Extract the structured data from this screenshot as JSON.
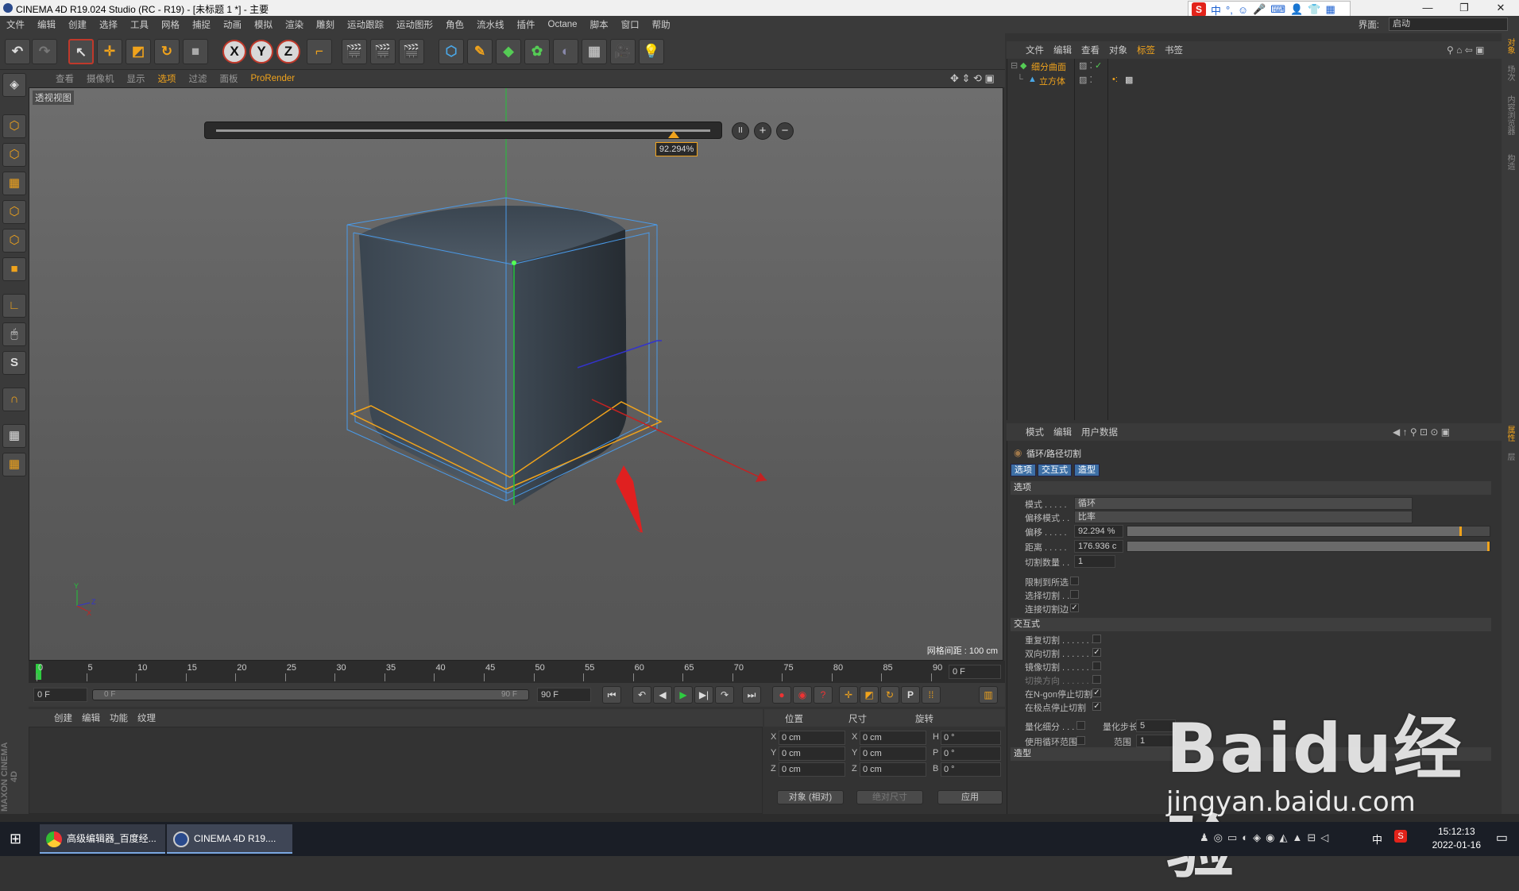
{
  "window": {
    "title": "CINEMA 4D R19.024 Studio (RC - R19) - [未标题 1 *] - 主要",
    "minimize": "—",
    "maximize": "❐",
    "close": "✕"
  },
  "ime": {
    "logo": "S",
    "lang": "中",
    "icons": [
      "°,",
      "☺",
      "🎤",
      "⌨",
      "👤",
      "👕",
      "▦"
    ]
  },
  "menu": [
    "文件",
    "编辑",
    "创建",
    "选择",
    "工具",
    "网格",
    "捕捉",
    "动画",
    "模拟",
    "渲染",
    "雕刻",
    "运动跟踪",
    "运动图形",
    "角色",
    "流水线",
    "插件",
    "Octane",
    "脚本",
    "窗口",
    "帮助"
  ],
  "layout": {
    "label": "界面:",
    "value": "启动"
  },
  "viewport": {
    "menu": [
      "查看",
      "摄像机",
      "显示",
      "选项",
      "过滤",
      "面板",
      "ProRender"
    ],
    "active_menu": "选项",
    "title": "透视视图",
    "grid_info": "网格间距 : 100 cm",
    "slider_value": "92.294%",
    "slider_fraction": 0.92294,
    "buttons": {
      "pause": "II",
      "plus": "+",
      "minus": "−"
    },
    "axis": {
      "y": "Y",
      "x": "X",
      "z": "Z"
    }
  },
  "timeline": {
    "ticks": [
      "0",
      "5",
      "10",
      "15",
      "20",
      "25",
      "30",
      "35",
      "40",
      "45",
      "50",
      "55",
      "60",
      "65",
      "70",
      "75",
      "80",
      "85",
      "90"
    ],
    "current_frame": "0 F",
    "start": "0 F",
    "range_start": "0 F",
    "range_end": "90 F",
    "end": "90 F"
  },
  "material_manager": {
    "menu": [
      "创建",
      "编辑",
      "功能",
      "纹理"
    ],
    "brand": "MAXON CINEMA 4D"
  },
  "coordinates": {
    "headers": [
      "位置",
      "尺寸",
      "旋转"
    ],
    "rows": [
      {
        "pos_axis": "X",
        "pos": "0 cm",
        "size_axis": "X",
        "size": "0 cm",
        "rot_axis": "H",
        "rot": "0 °"
      },
      {
        "pos_axis": "Y",
        "pos": "0 cm",
        "size_axis": "Y",
        "size": "0 cm",
        "rot_axis": "P",
        "rot": "0 °"
      },
      {
        "pos_axis": "Z",
        "pos": "0 cm",
        "size_axis": "Z",
        "size": "0 cm",
        "rot_axis": "B",
        "rot": "0 °"
      }
    ],
    "mode": "对象 (相对)",
    "size_mode": "绝对尺寸",
    "apply": "应用"
  },
  "object_manager": {
    "menu": [
      "文件",
      "编辑",
      "查看",
      "对象",
      "标签",
      "书签"
    ],
    "active_menu": "标签",
    "objects": [
      {
        "name": "细分曲面",
        "color": "#f0a31c"
      },
      {
        "name": "立方体",
        "color": "#f0a31c"
      }
    ]
  },
  "attribute_manager": {
    "menu": [
      "模式",
      "编辑",
      "用户数据"
    ],
    "tool_name": "循环/路径切割",
    "tabs": [
      "选项",
      "交互式",
      "造型"
    ],
    "section_options": "选项",
    "mode_label": "模式 . . . . .",
    "mode_value": "循环",
    "offset_mode_label": "偏移模式 . .",
    "offset_mode_value": "比率",
    "offset_label": "偏移 . . . . .",
    "offset_value": "92.294 %",
    "offset_fraction": 0.92294,
    "distance_label": "距离 . . . . .",
    "distance_value": "176.936 c",
    "distance_fraction": 1.0,
    "cuts_label": "切割数量 . .",
    "cuts_value": "1",
    "restrict_label": "限制到所选",
    "select_cut_label": "选择切割 . .",
    "connect_cut_label": "连接切割边",
    "section_interactive": "交互式",
    "repeat_cut_label": "重复切割 . . . . . . . .",
    "bidir_cut_label": "双向切割 . . . . . . . .",
    "mirror_cut_label": "镜像切割 . . . . . . . .",
    "switch_dir_label": "切换方向 . . . . . . . .",
    "ngon_stop_label": "在N-gon停止切割",
    "pole_stop_label": "在极点停止切割",
    "quantize_label": "量化细分 . . . .",
    "quantize_step_label": "量化步长",
    "quantize_step_value": "5",
    "loop_range_label": "使用循环范围",
    "range_label": "范围",
    "range_value": "1",
    "section_shape": "造型"
  },
  "right_strip": [
    "对象",
    "场次",
    "内容浏览器",
    "构造",
    "属性",
    "层"
  ],
  "taskbar": {
    "tasks": [
      "高级编辑器_百度经...",
      "CINEMA 4D R19...."
    ],
    "tray_lang": "中",
    "time": "15:12:13",
    "date": "2022-01-16"
  },
  "watermark": {
    "main": "Baidu经验",
    "sub": "jingyan.baidu.com"
  },
  "colors": {
    "accent": "#f0a31c",
    "selected_tab": "#3d6fa5",
    "axis_y": "#22c43a",
    "axis_x": "#c42222",
    "axis_z": "#3333cc"
  }
}
